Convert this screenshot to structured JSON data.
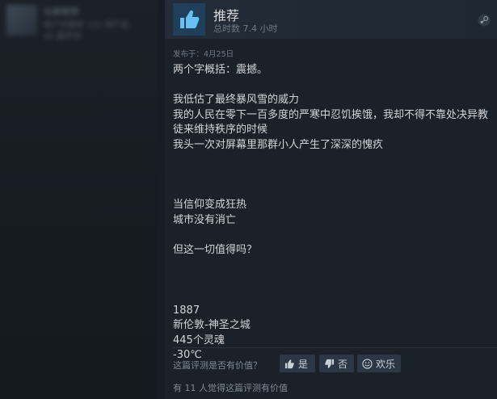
{
  "sidebar": {
    "user_name": "玩家昵称",
    "line1": "帐户内拥有 123 项产品",
    "line2": "45 篇评测"
  },
  "review": {
    "verdict": "推荐",
    "hours": "总时数 7.4 小时",
    "posted": "发布于：4月25日",
    "body_lines": [
      "两个字概括：震撼。",
      "",
      "我低估了最终暴风雪的威力",
      "我的人民在零下一百多度的严寒中忍饥挨饿，我却不得不靠处决异教",
      "徒来维持秩序的时候",
      "我头一次对屏幕里那群小人产生了深深的愧疚",
      "",
      "",
      "",
      "当信仰变成狂热",
      "城市没有消亡",
      "",
      "但这一切值得吗？",
      "",
      "",
      "",
      "1887",
      "新伦敦-神圣之城",
      "445个灵魂",
      "-30℃"
    ]
  },
  "feedback": {
    "question": "这篇评测是否有价值？",
    "yes_label": "是",
    "no_label": "否",
    "funny_label": "欢乐",
    "helpful_count": "有 11 人觉得这篇评测有价值"
  },
  "colors": {
    "background": "#171d25",
    "panel": "#1b2129",
    "thumb_blue": "#66c0f4",
    "button_bg": "#2b3745"
  }
}
